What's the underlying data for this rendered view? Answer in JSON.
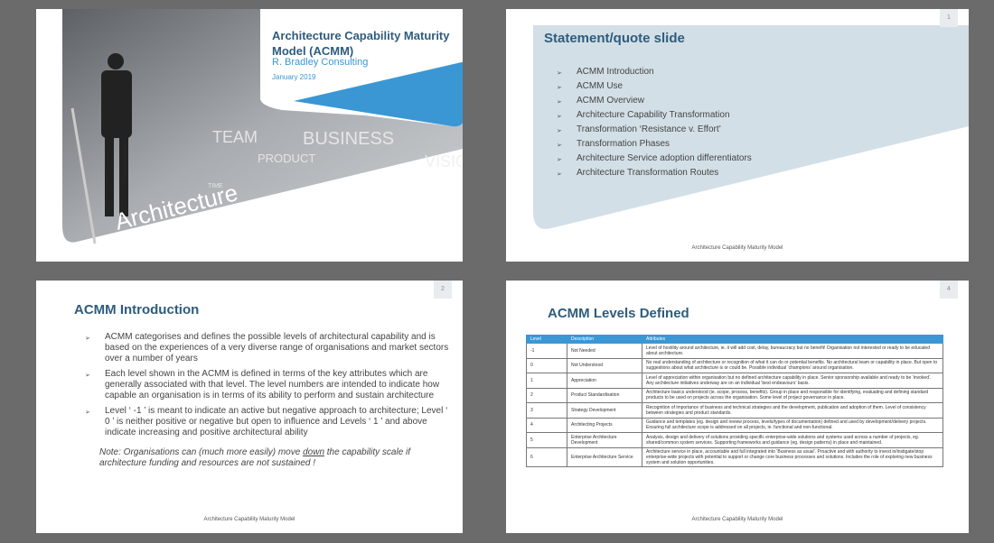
{
  "slides": [
    {
      "title": "Architecture Capability Maturity Model (ACMM)",
      "subtitle": "R. Bradley Consulting",
      "date": "January 2019",
      "image_caption": "Architecture",
      "image_words": [
        "TEAM",
        "BUSINESS",
        "PRODUCT",
        "VISION",
        "TIME"
      ]
    },
    {
      "number": "1",
      "title": "Statement/quote slide",
      "items": [
        "ACMM Introduction",
        "ACMM Use",
        "ACMM Overview",
        "Architecture Capability Transformation",
        "Transformation ‘Resistance v. Effort’",
        "Transformation Phases",
        "Architecture Service adoption differentiators",
        "Architecture Transformation Routes"
      ],
      "footer": "Architecture Capability Maturity Model"
    },
    {
      "number": "2",
      "title": "ACMM Introduction",
      "items": [
        "ACMM categorises and defines the possible levels of architectural capability and is based on the experiences of a very diverse range of organisations and market sectors over a number of years",
        "Each level shown in the ACMM is defined in terms of the key attributes which are generally associated with that level. The level numbers are intended to indicate how capable an organisation is in terms of its ability to perform and sustain architecture",
        "Level ‘ -1 ’ is meant to indicate an active but negative approach to architecture; Level ‘ 0 ’ is neither positive or negative but open to influence and Levels ‘ 1 ’ and above indicate increasing and positive architectural ability"
      ],
      "note_before": "Note: Organisations can (much more easily) move ",
      "note_emph": "down",
      "note_after": " the capability scale if architecture funding and resources are not sustained !",
      "footer": "Architecture Capability Maturity Model"
    },
    {
      "number": "4",
      "title": "ACMM Levels Defined",
      "headers": [
        "Level",
        "Description",
        "Attributes"
      ],
      "rows": [
        [
          "-1",
          "Not Needed",
          "Level of hostility around architecture, ie. it will add cost, delay, bureaucracy but no benefit! Organisation not interested or ready to be educated about architecture."
        ],
        [
          "0",
          "Not Understood",
          "No real understanding of architecture or recognition of what it can do or potential benefits. No architectural team or capability in place. But open to suggestions about what architecture is or could be. Possible individual ‘champions’ around organisation."
        ],
        [
          "1",
          "Appreciation",
          "Level of appreciation within organisation but no defined architecture capability in place. Senior sponsorship available and ready to be ‘invoked’. Any architecture initiatives underway are on an individual ‘best endeavours’ basis."
        ],
        [
          "2",
          "Product Standardisation",
          "Architecture basics understood (ie. scope, process, benefits). Group in place and responsible for identifying, evaluating and defining standard products to be used on projects across the organisation. Some level of project governance in place."
        ],
        [
          "3",
          "Strategy Development",
          "Recognition of importance of business and technical strategies and the development, publication and adoption of them. Level of consistency between strategies and product standards."
        ],
        [
          "4",
          "Architecting Projects",
          "Guidance and templates (eg. design and review process, levels/types of documentation) defined and used by development/delivery projects. Ensuring full architecture scope is addressed on all projects, ie. functional and non-functional."
        ],
        [
          "5",
          "Enterprise Architecture Development",
          "Analysis, design and delivery of solutions providing specific enterprise-wide solutions and systems used across a number of projects, eg. shared/common system services. Supporting frameworks and guidance (eg. design patterns) in place and maintained."
        ],
        [
          "6",
          "Enterprise Architecture Service",
          "Architecture service in place, accountable and full integrated into ‘Business as usual’. Proactive and with authority to invest in/instigate/stop enterprise-wide projects with potential to support or change core business processes and solutions. Includes the role of exploring new business system and solution opportunities."
        ]
      ],
      "footer": "Architecture Capability Maturity Model"
    }
  ],
  "colors": {
    "accent": "#3a97d4",
    "title": "#2e5c7d",
    "shape": "#d3dfe6",
    "background": "#6b6b6b"
  }
}
